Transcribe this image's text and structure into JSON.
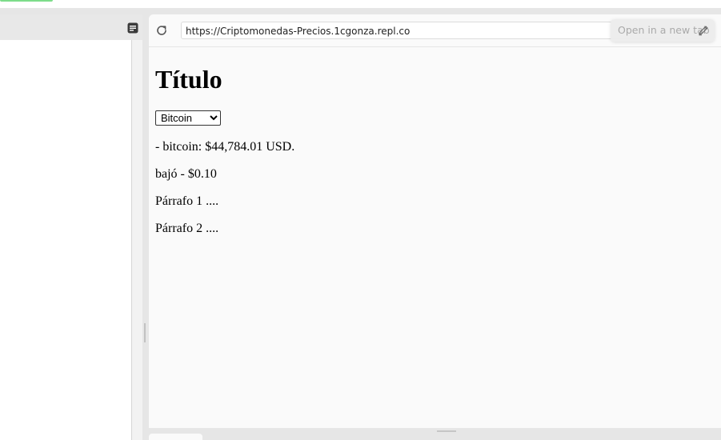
{
  "webview": {
    "url": "https://Criptomonedas-Precios.1cgonza.repl.co",
    "open_in_new_tab_label": "Open in a new tab"
  },
  "page": {
    "title": "Título",
    "coin_select": {
      "selected": "Bitcoin"
    },
    "price_line": "- bitcoin: $44,784.01 USD.",
    "change_line": "bajó - $0.10",
    "paragraph_1": "Párrafo 1 ....",
    "paragraph_2": "Párrafo 2 ...."
  },
  "icons": {
    "document": "document-icon",
    "reload": "reload-icon",
    "pen": "pen-icon"
  }
}
